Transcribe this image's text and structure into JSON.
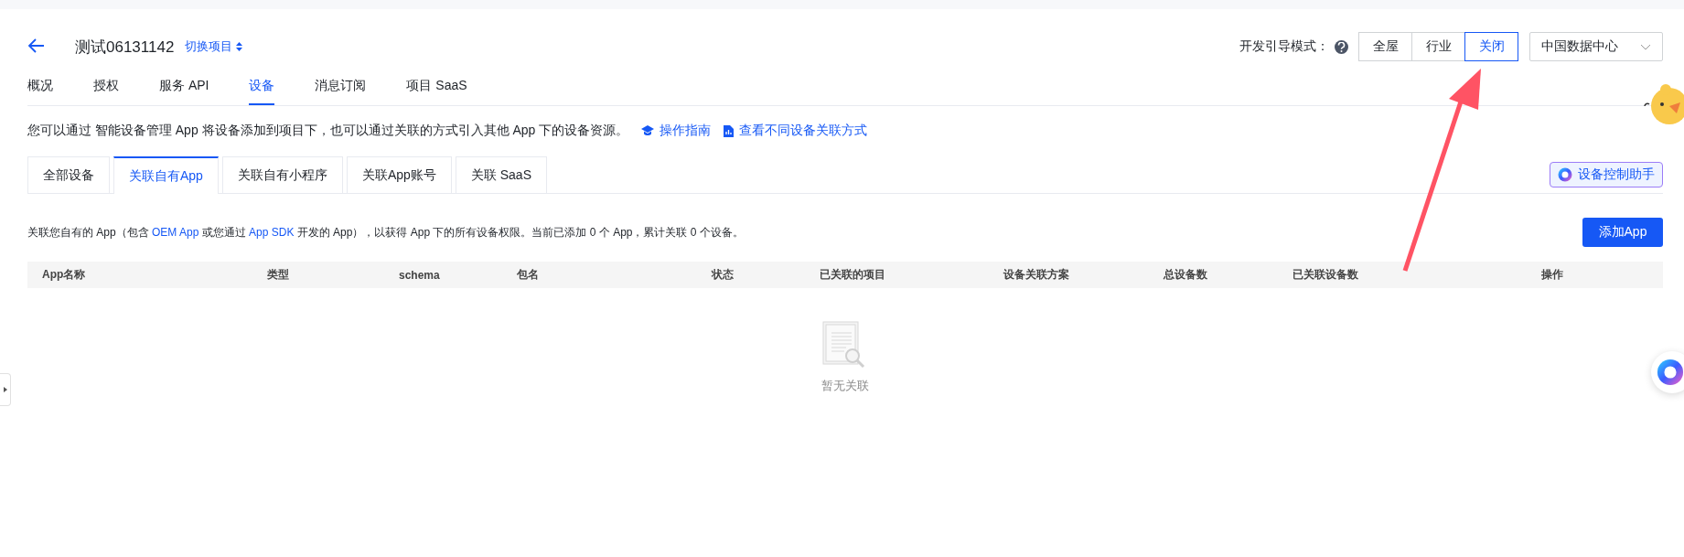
{
  "header": {
    "title": "测试06131142",
    "switch_label": "切换项目"
  },
  "guide": {
    "label": "开发引导模式：",
    "options": [
      {
        "label": "全屋",
        "selected": false
      },
      {
        "label": "行业",
        "selected": false
      },
      {
        "label": "关闭",
        "selected": true
      }
    ],
    "region": "中国数据中心"
  },
  "nav_tabs": [
    {
      "label": "概况",
      "selected": false
    },
    {
      "label": "授权",
      "selected": false
    },
    {
      "label": "服务 API",
      "selected": false
    },
    {
      "label": "设备",
      "selected": true
    },
    {
      "label": "消息订阅",
      "selected": false
    },
    {
      "label": "项目 SaaS",
      "selected": false
    }
  ],
  "description": {
    "text": "您可以通过 智能设备管理 App 将设备添加到项目下，也可以通过关联的方式引入其他 App 下的设备资源。",
    "links": [
      "操作指南",
      "查看不同设备关联方式"
    ]
  },
  "sub_tabs": [
    {
      "label": "全部设备",
      "selected": false
    },
    {
      "label": "关联自有App",
      "selected": true
    },
    {
      "label": "关联自有小程序",
      "selected": false
    },
    {
      "label": "关联App账号",
      "selected": false
    },
    {
      "label": "关联 SaaS",
      "selected": false
    }
  ],
  "assistant_button": "设备控制助手",
  "info": [
    {
      "kind": "text",
      "text": "关联您自有的 App（包含 "
    },
    {
      "kind": "link",
      "text": "OEM App"
    },
    {
      "kind": "text",
      "text": " 或您通过 "
    },
    {
      "kind": "link",
      "text": "App SDK"
    },
    {
      "kind": "text",
      "text": " 开发的 App），以获得 App 下的所有设备权限。当前已添加 0 个 App，累计关联 0 个设备。"
    }
  ],
  "add_button": "添加App",
  "table": {
    "columns": [
      "App名称",
      "类型",
      "schema",
      "包名",
      "状态",
      "已关联的项目",
      "设备关联方案",
      "总设备数",
      "已关联设备数",
      "操作"
    ],
    "empty_text": "暂无关联"
  }
}
